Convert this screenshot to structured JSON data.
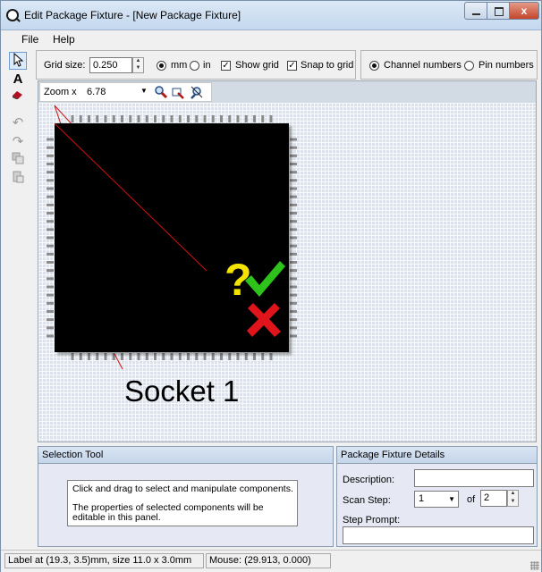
{
  "window": {
    "title": "Edit Package Fixture - [New Package Fixture]",
    "controls": {
      "minimize": "minimize",
      "maximize": "maximize",
      "close": "x"
    }
  },
  "menu": {
    "file": "File",
    "help": "Help"
  },
  "toolbar": {
    "grid_size_label": "Grid size:",
    "grid_size_value": "0.250",
    "unit_mm": "mm",
    "unit_in": "in",
    "unit_selected": "mm",
    "show_grid_label": "Show grid",
    "show_grid_checked": true,
    "snap_to_grid_label": "Snap to grid",
    "snap_to_grid_checked": true,
    "channel_numbers_label": "Channel numbers",
    "pin_numbers_label": "Pin numbers",
    "numbering_selected": "Channel numbers"
  },
  "tools": [
    "selection-tool-icon",
    "text-tool-icon",
    "eraser-tool-icon",
    "undo-icon",
    "redo-icon",
    "copy-icon",
    "paste-icon"
  ],
  "canvas": {
    "zoom_label": "Zoom x",
    "zoom_value": "6.78",
    "socket_label": "Socket 1",
    "status_marks": {
      "question": "?",
      "check": "✓",
      "cross": "✗"
    }
  },
  "selection_panel": {
    "title": "Selection Tool",
    "line1": "Click and drag to select and manipulate components.",
    "line2": "The properties of selected components will be editable in this panel."
  },
  "details_panel": {
    "title": "Package Fixture Details",
    "description_label": "Description:",
    "description_value": "",
    "scan_step_label": "Scan Step:",
    "scan_step_value": "1",
    "of_label": "of",
    "total_steps": "2",
    "step_prompt_label": "Step Prompt:",
    "step_prompt_value": ""
  },
  "status": {
    "label_info": "Label at (19.3, 3.5)mm, size 11.0 x 3.0mm",
    "mouse_info": "Mouse: (29.913, 0.000)"
  },
  "colors": {
    "chip": "#000000",
    "question_mark": "#f2e400",
    "check_mark": "#2ec31b",
    "cross_mark": "#e0141b",
    "guide_line": "#d01010"
  }
}
